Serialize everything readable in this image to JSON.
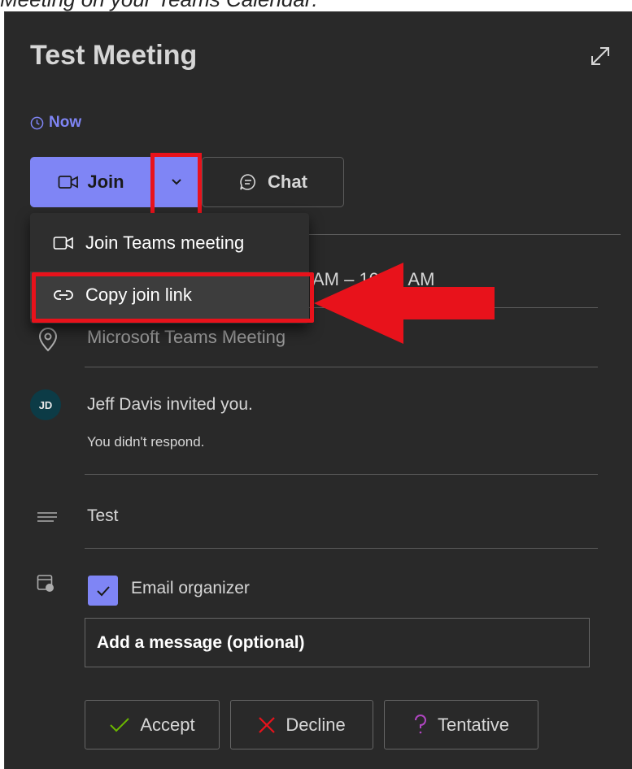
{
  "caption": "Meeting on your Teams Calendar:",
  "meeting": {
    "title": "Test Meeting",
    "time_status": "Now",
    "partial_time": "AM – 10:30 AM",
    "location": "Microsoft Teams Meeting"
  },
  "actions": {
    "join_label": "Join",
    "chat_label": "Chat"
  },
  "join_menu": {
    "items": [
      {
        "label": "Join Teams meeting",
        "icon": "video-camera-icon"
      },
      {
        "label": "Copy join link",
        "icon": "link-icon"
      }
    ]
  },
  "organizer": {
    "initials": "JD",
    "invite_text": "Jeff Davis invited you.",
    "response_status": "You didn't respond."
  },
  "notes": "Test",
  "rsvp": {
    "email_organizer_label": "Email organizer",
    "email_organizer_checked": true,
    "message_placeholder": "Add a message (optional)",
    "accept_label": "Accept",
    "decline_label": "Decline",
    "tentative_label": "Tentative"
  },
  "colors": {
    "accent": "#7f85f5",
    "panel_background": "#292929",
    "highlight": "#e8121b",
    "accept_icon": "#6bb700",
    "decline_icon": "#e8121b",
    "tentative_icon": "#b146c2"
  }
}
